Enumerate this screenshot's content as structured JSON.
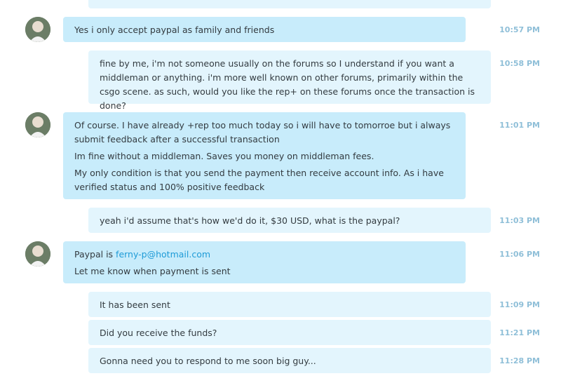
{
  "messages": [
    {
      "sender": "them",
      "time": "10:57 PM",
      "lines": [
        "Yes i only accept paypal as family and friends"
      ]
    },
    {
      "sender": "me",
      "time": "10:58 PM",
      "lines": [
        "fine by me, i'm not someone usually on the forums so I understand if you want a middleman or anything. i'm more well known on other forums, primarily within the csgo scene. as such, would you like the rep+ on these forums once the transaction is done?"
      ]
    },
    {
      "sender": "them",
      "time": "11:01 PM",
      "lines": [
        "Of course. I have already +rep too much today so i will have to tomorroe but i always submit feedback after a successful transaction",
        "Im fine without a middleman. Saves you money on middleman fees.",
        "My only condition is that you send the payment then receive account info. As i have verified status and 100% positive feedback"
      ]
    },
    {
      "sender": "me",
      "time": "11:03 PM",
      "lines": [
        "yeah i'd assume that's how we'd do it, $30 USD, what is the paypal?"
      ]
    },
    {
      "sender": "them",
      "time": "11:06 PM",
      "lines": [
        "Paypal is ",
        "ferny-p@hotmail.com",
        "Let me know when payment is sent"
      ]
    },
    {
      "sender": "me",
      "time": "11:09 PM",
      "lines": [
        "It has been sent"
      ]
    },
    {
      "sender": "me",
      "time": "11:21 PM",
      "lines": [
        "Did you receive the funds?"
      ]
    },
    {
      "sender": "me",
      "time": "11:28 PM",
      "lines": [
        "Gonna need you to respond to me soon big guy..."
      ]
    }
  ],
  "colors": {
    "incoming": "#c8ecfb",
    "outgoing": "#e3f5fd",
    "timestamp": "#8fbfd8",
    "link": "#1e9bd7"
  }
}
